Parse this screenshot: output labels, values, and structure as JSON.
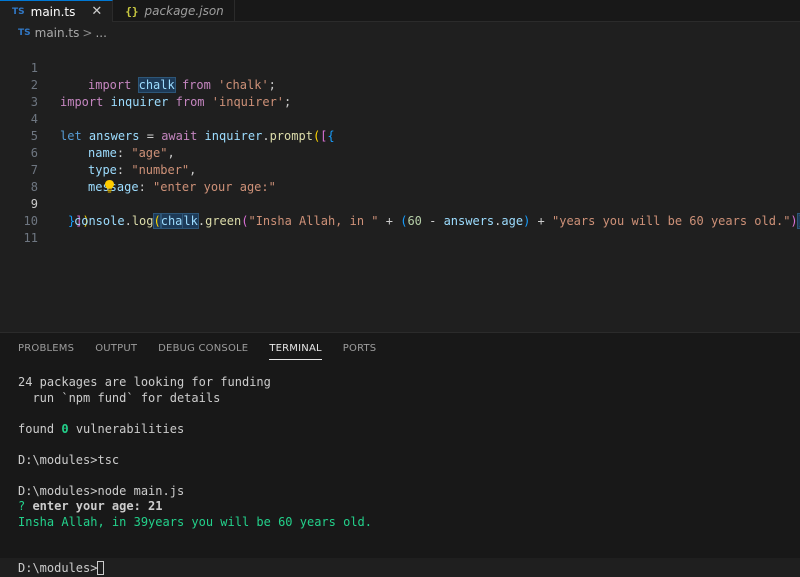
{
  "tabs": [
    {
      "icon": "TS",
      "label": "main.ts",
      "close": "✕"
    },
    {
      "icon": "{}",
      "label": "package.json"
    }
  ],
  "breadcrumb": {
    "icon": "TS",
    "file": "main.ts",
    "sep": ">",
    "rest": "..."
  },
  "editor": {
    "line_numbers": [
      "1",
      "2",
      "3",
      "4",
      "5",
      "6",
      "7",
      "8",
      "9",
      "10",
      "11"
    ],
    "code": {
      "l1_import": "import",
      "l1_chalk": "chalk",
      "l1_from": "from",
      "l1_str": "'chalk'",
      "l1_semi": ";",
      "l2_import": "import",
      "l2_inquirer": "inquirer",
      "l2_from": "from",
      "l2_str": "'inquirer'",
      "l2_semi": ";",
      "l4_let": "let",
      "l4_answers": "answers",
      "l4_eq": " = ",
      "l4_await": "await",
      "l4_inquirer": "inquirer",
      "l4_dot": ".",
      "l4_prompt": "prompt",
      "l4_paren": "(",
      "l4_bracket": "[",
      "l4_brace": "{",
      "l5_key": "name",
      "l5_colon": ": ",
      "l5_val": "\"age\"",
      "l5_comma": ",",
      "l6_key": "type",
      "l6_colon": ": ",
      "l6_val": "\"number\"",
      "l6_comma": ",",
      "l7_key": "message",
      "l7_colon": ": ",
      "l7_val": "\"enter your age:\"",
      "l8_brace": "}",
      "l8_bracket": "]",
      "l8_paren": ")",
      "l9_console": "console",
      "l9_dot1": ".",
      "l9_log": "log",
      "l9_paren": "(",
      "l9_chalk_a": "cha",
      "l9_chalk_b": "lk",
      "l9_dot2": ".",
      "l9_green": "green",
      "l9_paren2": "(",
      "l9_str1": "\"Insha Allah, in \"",
      "l9_plus1": " + ",
      "l9_paren3": "(",
      "l9_num": "60",
      "l9_minus": " - ",
      "l9_answers": "answers",
      "l9_dot3": ".",
      "l9_age": "age",
      "l9_paren3c": ")",
      "l9_plus2": " + ",
      "l9_str2": "\"years you will be 60 years old.\"",
      "l9_paren2c": ")",
      "l9_parenc": ")",
      "l9_semi": ";"
    }
  },
  "panel": {
    "tabs": [
      "PROBLEMS",
      "OUTPUT",
      "DEBUG CONSOLE",
      "TERMINAL",
      "PORTS"
    ],
    "active_tab": "TERMINAL"
  },
  "terminal": {
    "funding_1": "24 packages are looking for funding",
    "funding_2": "  run `npm fund` for details",
    "found_pre": "found ",
    "found_count": "0",
    "found_post": " vulnerabilities",
    "prompt_tsc": "D:\\modules>tsc",
    "prompt_node": "D:\\modules>node main.js",
    "q_mark": "?",
    "q_text": " enter your age:",
    "q_answer": " 21",
    "result": "Insha Allah, in 39years you will be 60 years old.",
    "prompt_final": "D:\\modules>"
  },
  "colors": {
    "background": "#1f1f1f",
    "keyword_control": "#c586c0",
    "keyword_decl": "#569cd6",
    "variable": "#9cdcfe",
    "string": "#ce9178",
    "function": "#dcdcaa",
    "terminal_green": "#23d18b"
  }
}
